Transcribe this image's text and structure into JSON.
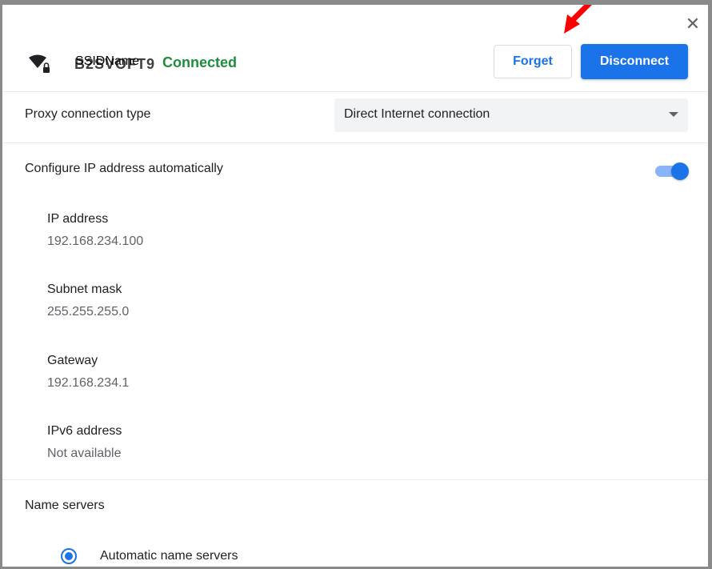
{
  "dialog": {
    "close_glyph": "✕",
    "close_icon": "close-icon"
  },
  "header": {
    "wifi_icon": "wifi-icon",
    "ssid_shadow_text": "B2SVOFT9",
    "ssid_label": "SSIDName",
    "status": "Connected",
    "forget_label": "Forget",
    "disconnect_label": "Disconnect",
    "status_color": "#1e8e3e",
    "accent_color": "#1a73e8",
    "annotation_arrow_color": "#ff0000"
  },
  "proxy": {
    "label": "Proxy connection type",
    "selected": "Direct Internet connection"
  },
  "ip_config": {
    "auto_label": "Configure IP address automatically",
    "auto_enabled": true,
    "fields": [
      {
        "title": "IP address",
        "value": "192.168.234.100"
      },
      {
        "title": "Subnet mask",
        "value": "255.255.255.0"
      },
      {
        "title": "Gateway",
        "value": "192.168.234.1"
      },
      {
        "title": "IPv6 address",
        "value": "Not available"
      }
    ]
  },
  "name_servers": {
    "label": "Name servers",
    "option_selected": "Automatic name servers"
  }
}
